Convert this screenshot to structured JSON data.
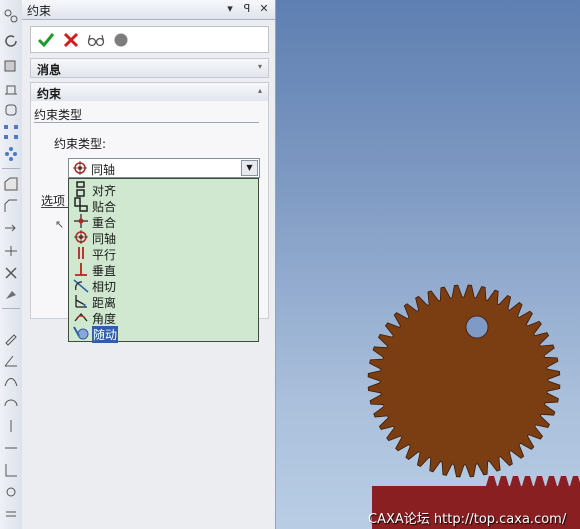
{
  "panel": {
    "title": "约束",
    "pin_glyph": "ꟼ",
    "close_glyph": "✕",
    "dropdown_glyph": "▾"
  },
  "actions": [
    {
      "name": "ok-button",
      "icon": "check-icon"
    },
    {
      "name": "cancel-button",
      "icon": "x-icon"
    },
    {
      "name": "preview-button",
      "icon": "glasses-icon"
    },
    {
      "name": "record-button",
      "icon": "dot-icon"
    }
  ],
  "sections": {
    "messages": {
      "label": "消息",
      "arrow": "▾"
    },
    "constraint": {
      "label": "约束",
      "arrow": "▴"
    }
  },
  "constraint": {
    "group_title": "约束类型",
    "type_label": "约束类型:",
    "selected": "同轴",
    "options_label": "选项"
  },
  "options": [
    {
      "label": "对齐",
      "icon": "align-icon"
    },
    {
      "label": "贴合",
      "icon": "mate-icon"
    },
    {
      "label": "重合",
      "icon": "coincident-icon"
    },
    {
      "label": "同轴",
      "icon": "concentric-icon"
    },
    {
      "label": "平行",
      "icon": "parallel-icon"
    },
    {
      "label": "垂直",
      "icon": "perpendicular-icon"
    },
    {
      "label": "相切",
      "icon": "tangent-icon"
    },
    {
      "label": "距离",
      "icon": "distance-icon"
    },
    {
      "label": "角度",
      "icon": "angle-icon"
    },
    {
      "label": "随动",
      "icon": "follow-icon",
      "selected": true
    }
  ],
  "colors": {
    "gear": "#7b3d12",
    "rack": "#8a1f22",
    "list_bg": "#cfe8cf",
    "selection": "#2f5fa8"
  },
  "watermark": "CAXA论坛 http://top.caxa.com/"
}
